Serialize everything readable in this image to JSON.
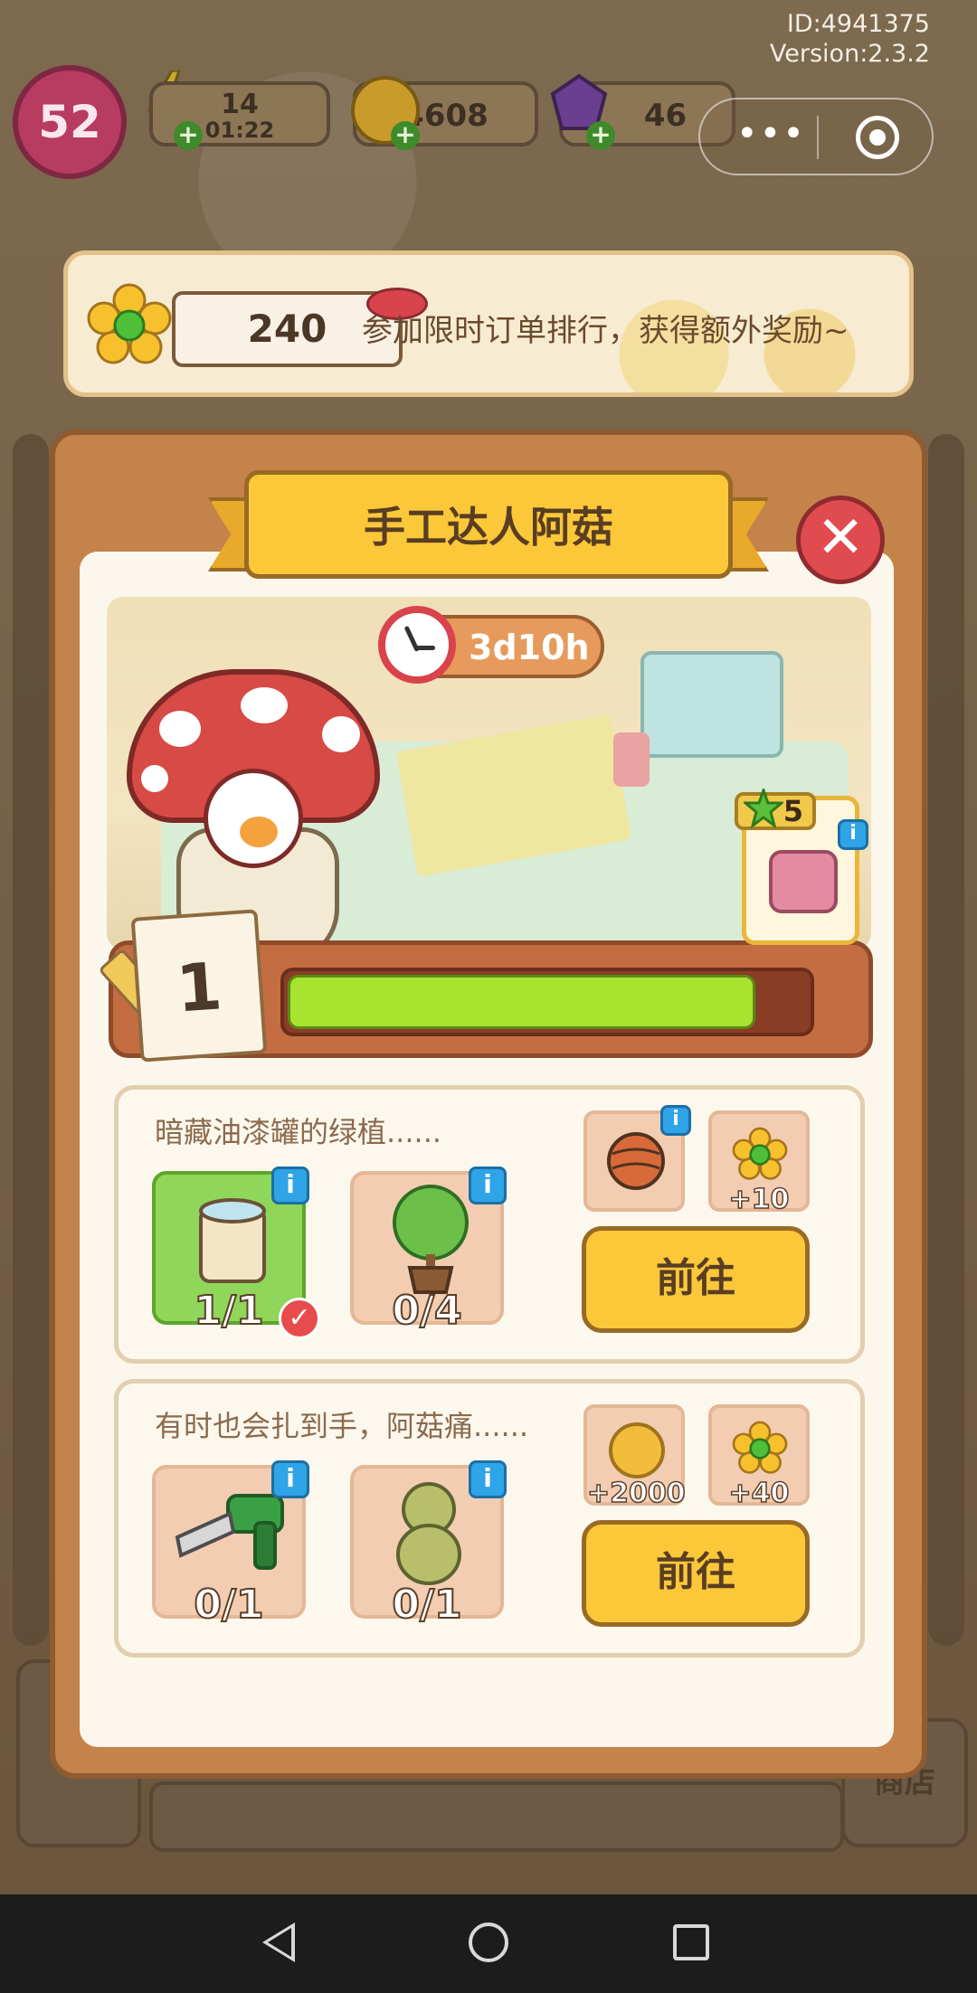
{
  "header": {
    "id_text": "ID:4941375",
    "version_text": "Version:2.3.2",
    "level": "52",
    "energy_value": "14",
    "energy_timer": "01:22",
    "coins": "4608",
    "gems": "46"
  },
  "banner": {
    "score": "240",
    "text": "参加限时订单排行，获得额外奖励~"
  },
  "panel": {
    "title": "手工达人阿菇",
    "timer": "3d10h",
    "progress_level": "1",
    "progress_fraction": 0.9,
    "star_reward": "5"
  },
  "tasks": [
    {
      "description": "暗藏油漆罐的绿植......",
      "items": [
        {
          "icon": "paint-can-icon",
          "count": "1/1",
          "done": true
        },
        {
          "icon": "potted-plant-icon",
          "count": "0/4",
          "done": false
        }
      ],
      "rewards": [
        {
          "icon": "yarn-bag-icon",
          "amount": ""
        },
        {
          "icon": "flower-icon",
          "amount": "+10"
        }
      ],
      "button": "前往"
    },
    {
      "description": "有时也会扎到手，阿菇痛......",
      "items": [
        {
          "icon": "drill-saw-icon",
          "count": "0/1",
          "done": false
        },
        {
          "icon": "plush-bear-icon",
          "count": "0/1",
          "done": false
        }
      ],
      "rewards": [
        {
          "icon": "coin-icon",
          "amount": "+2000"
        },
        {
          "icon": "flower-icon",
          "amount": "+40"
        }
      ],
      "button": "前往"
    }
  ],
  "background": {
    "shop_label": "商店"
  },
  "colors": {
    "accent_yellow": "#fbc83a",
    "progress_green": "#a8e32f",
    "close_red": "#e04b4f",
    "info_blue": "#2fa4e7"
  }
}
